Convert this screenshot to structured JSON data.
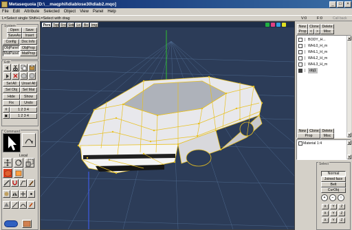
{
  "window": {
    "title": "Metasequoia [D:\\__maqphil\\diablose30\\diab2.mqo]",
    "min_label": "_",
    "max_label": "□",
    "close_label": "×"
  },
  "menu": [
    "File",
    "Edit",
    "Attribute",
    "Selected",
    "Object",
    "View",
    "Panel",
    "Help"
  ],
  "status": {
    "hint": "L=Select single  Shift+L=Select with drag",
    "vertex_count": "V:0",
    "face_count": "F:0",
    "callback": "Call back"
  },
  "left": {
    "system_label": "System",
    "open": "Open",
    "save": "Save",
    "save_as": "SaveAs",
    "insert": "Insert",
    "config": "Config",
    "doc_info": "Doc Info",
    "obj_panel": "ObjPanel",
    "obj_prop": "ObjProp",
    "mat_panel": "MatPanel",
    "mat_prop": "MatProp",
    "edit_label": "Edit",
    "sel_all": "Sel All",
    "unsel_all": "Unsel All",
    "sel_obj": "Sel Obj",
    "sel_mat": "Sel Mat",
    "hide": "Hide",
    "show": "Show",
    "fix": "Fix",
    "undo": "Undo",
    "nums_row1": "1 2 3 4",
    "nums_row2": "1 2 3 4",
    "command_label": "Command",
    "local_label": "Local"
  },
  "viewport": {
    "tabs": [
      "Pers",
      "Top",
      "Fro",
      "Side",
      "Ls",
      "Bo",
      "Img"
    ],
    "active_tab": "Pers"
  },
  "right": {
    "obj_buttons": [
      "New",
      "Clone",
      "Delete"
    ],
    "obj_buttons2": [
      "Prop",
      "<",
      ">",
      "Misc"
    ],
    "objects": [
      {
        "name": "BODY_H...",
        "visible": false,
        "locked": false
      },
      {
        "name": "WHL0_H_m",
        "visible": false,
        "locked": false
      },
      {
        "name": "WHL1_H_m",
        "visible": false,
        "locked": false
      },
      {
        "name": "WHL2_H_m",
        "visible": false,
        "locked": false
      },
      {
        "name": "WHL3_H_m",
        "visible": false,
        "locked": false
      },
      {
        "name": "obj1",
        "visible": true,
        "locked": false,
        "selected": true
      }
    ],
    "mat_buttons": [
      "New",
      "Clone",
      "Delete"
    ],
    "mat_buttons2": [
      "Prop",
      "Misc"
    ],
    "material": "Material 1:4"
  },
  "select": {
    "title": "Select",
    "normal": "Normal",
    "joined": "Joined face",
    "belt": "Belt",
    "curobj": "CurObj",
    "axis_x": "X",
    "axis_y": "Y",
    "axis_z": "Z"
  },
  "colors": {
    "title_bar_left": "#0a246a",
    "title_bar_right": "#3a6ea5",
    "viewport_bg": "#2c3c58",
    "grid": "#7090b0",
    "wire": "#e8c020",
    "y_axis": "#30c030",
    "z_axis": "#4060ff"
  }
}
